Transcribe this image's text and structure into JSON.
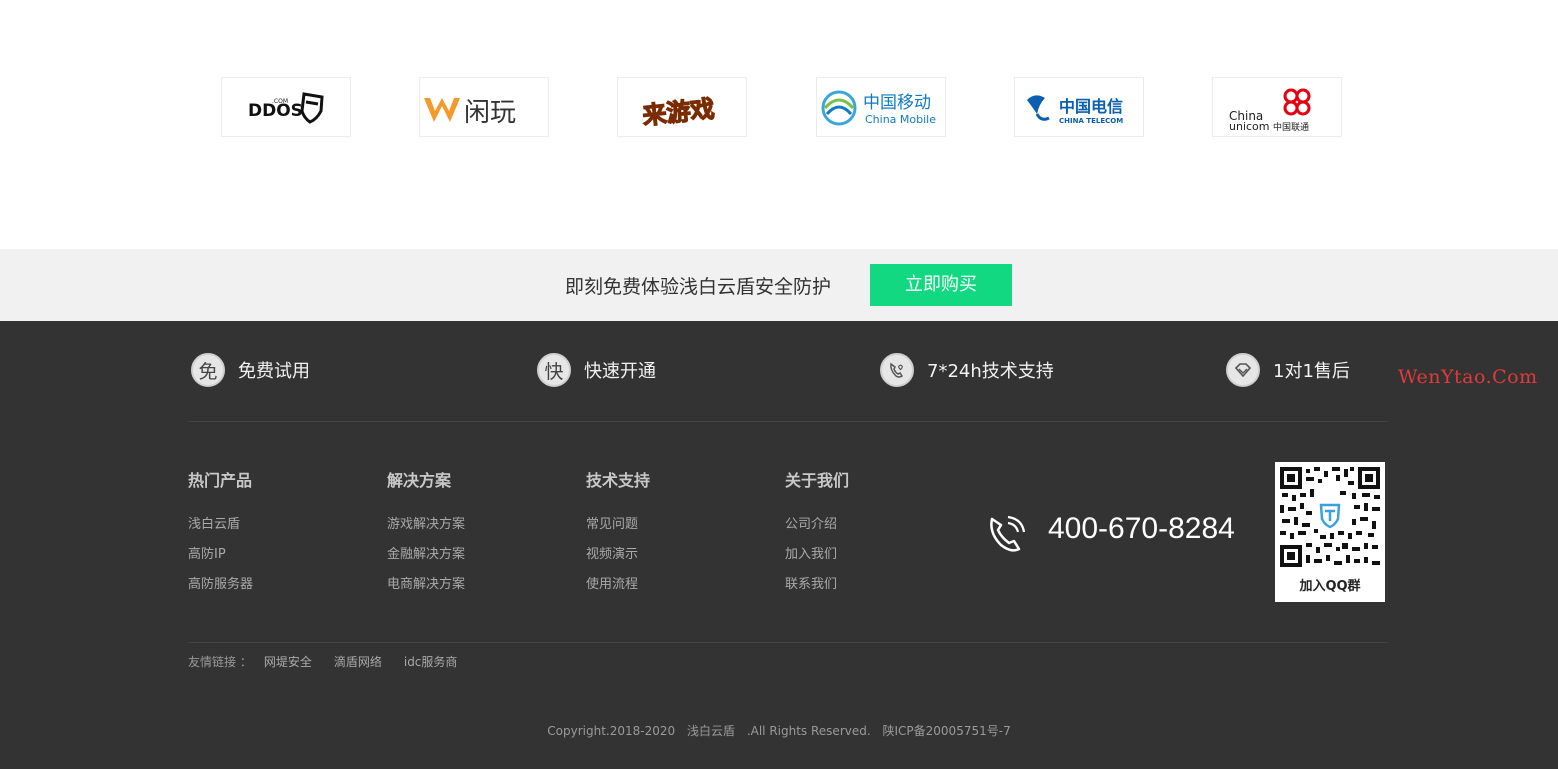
{
  "partners": [
    {
      "name": "DDOS.COM",
      "text": "DDOS",
      "sup": ".COM"
    },
    {
      "name": "W闲玩",
      "text": "闲玩"
    },
    {
      "name": "来游戏",
      "text": "来游戏"
    },
    {
      "name": "中国移动 China Mobile",
      "text_cn": "中国移动",
      "text_en": "China Mobile"
    },
    {
      "name": "中国电信 CHINA TELECOM",
      "text_cn": "中国电信",
      "text_en": "CHINA TELECOM"
    },
    {
      "name": "China unicom 中国联通",
      "text_en1": "China",
      "text_en2": "unicom",
      "text_cn": "中国联通"
    }
  ],
  "cta": {
    "text": "即刻免费体验浅白云盾安全防护",
    "button": "立即购买",
    "button_color": "#13d882"
  },
  "features": [
    {
      "badge": "免",
      "label": "免费试用"
    },
    {
      "badge": "快",
      "label": "快速开通"
    },
    {
      "badge": "",
      "icon": "phone-heart-icon",
      "label": "7*24h技术支持"
    },
    {
      "badge": "",
      "icon": "diamond-icon",
      "label": "1对1售后"
    }
  ],
  "columns": [
    {
      "title": "热门产品",
      "items": [
        "浅白云盾",
        "高防IP",
        "高防服务器"
      ]
    },
    {
      "title": "解决方案",
      "items": [
        "游戏解决方案",
        "金融解决方案",
        "电商解决方案"
      ]
    },
    {
      "title": "技术支持",
      "items": [
        "常见问题",
        "视频演示",
        "使用流程"
      ]
    },
    {
      "title": "关于我们",
      "items": [
        "公司介绍",
        "加入我们",
        "联系我们"
      ]
    }
  ],
  "contact": {
    "phone": "400-670-8284",
    "qr_label": "加入QQ群"
  },
  "friend_links": {
    "label": "友情链接 ：",
    "items": [
      "网堤安全",
      "滴盾网络",
      "idc服务商"
    ]
  },
  "copyright": {
    "text": "Copyright.2018-2020",
    "brand": "浅白云盾",
    "rights": ".All Rights Reserved.",
    "icp": "陕ICP备20005751号-7"
  },
  "watermark": "WenYtao.Com",
  "colors": {
    "footer_bg": "#333333",
    "cta_bg": "#f1f1f1",
    "accent_green": "#13d882"
  }
}
